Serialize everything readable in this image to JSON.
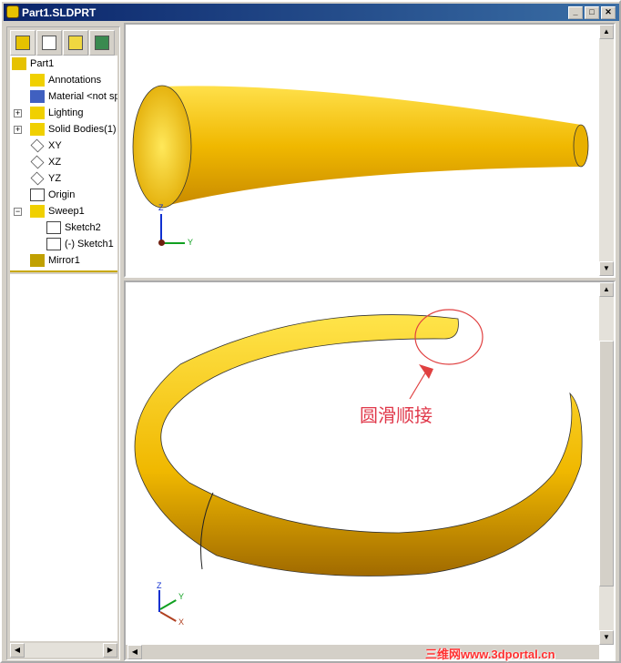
{
  "window": {
    "title": "Part1.SLDPRT",
    "controls": [
      "minimize",
      "maximize",
      "close"
    ]
  },
  "feature_tree": {
    "tabs": [
      "featuremanager",
      "propertymanager",
      "configurationmanager",
      "display"
    ],
    "items": [
      {
        "label": "Part1",
        "icon": "part-icon"
      },
      {
        "label": "Annotations",
        "icon": "annotations-icon"
      },
      {
        "label": "Material <not sp",
        "icon": "material-icon"
      },
      {
        "label": "Lighting",
        "icon": "lighting-icon",
        "expander": "+"
      },
      {
        "label": "Solid Bodies(1)",
        "icon": "solid-bodies-icon",
        "expander": "+"
      },
      {
        "label": "XY",
        "icon": "plane-icon"
      },
      {
        "label": "XZ",
        "icon": "plane-icon"
      },
      {
        "label": "YZ",
        "icon": "plane-icon"
      },
      {
        "label": "Origin",
        "icon": "origin-icon"
      },
      {
        "label": "Sweep1",
        "icon": "sweep-icon",
        "expander": "−"
      },
      {
        "label": "Sketch2",
        "icon": "sketch-icon"
      },
      {
        "label": "(-) Sketch1",
        "icon": "sketch-icon"
      },
      {
        "label": "Mirror1",
        "icon": "mirror-icon"
      }
    ]
  },
  "viewports": {
    "top": {
      "triad": {
        "z": "Z",
        "y": "Y"
      }
    },
    "bottom": {
      "triad": {
        "z": "Z",
        "y": "Y",
        "x": "X"
      },
      "annotation": "圆滑顺接"
    }
  },
  "watermark": "三维网www.3dportal.cn",
  "colors": {
    "model": "#f2c400",
    "title_bar": "#0a246a",
    "annotation": "#e0384a"
  }
}
